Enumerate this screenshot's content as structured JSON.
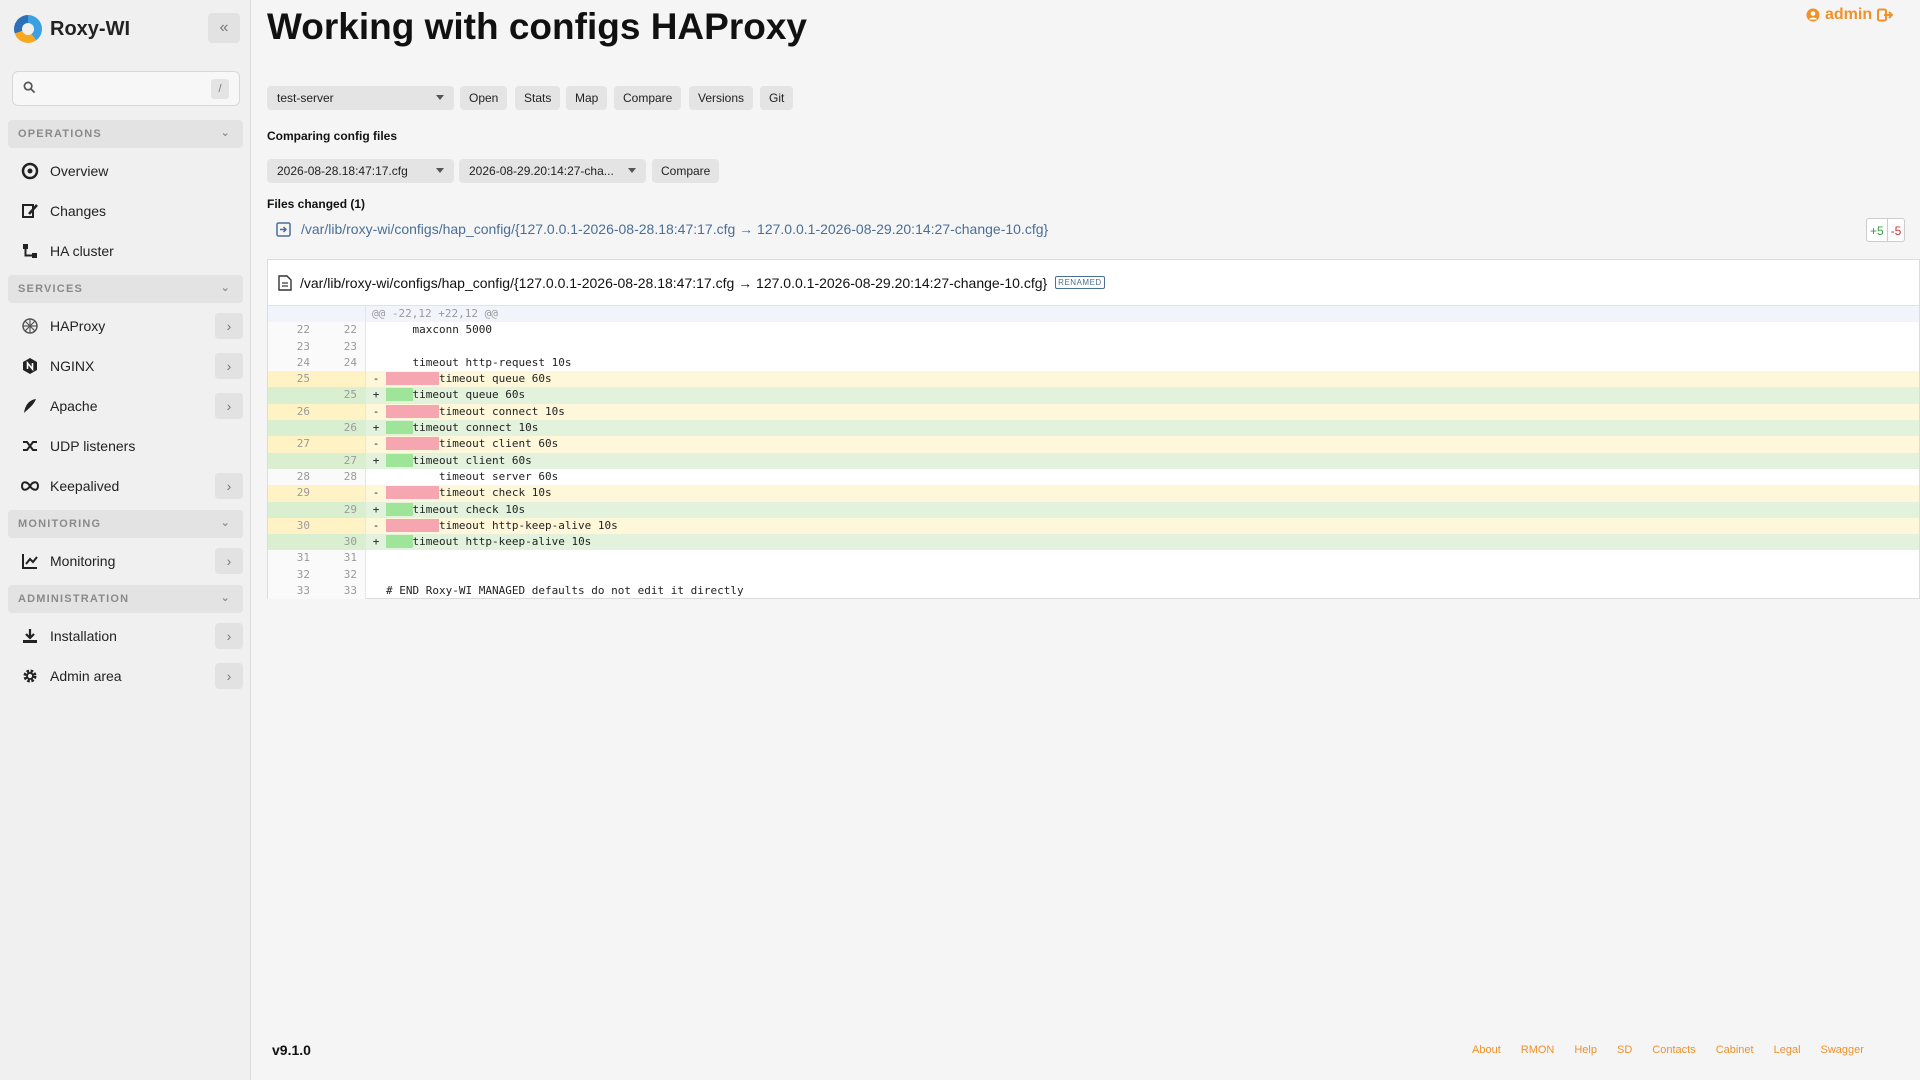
{
  "app": {
    "name": "Roxy-WI",
    "version": "v9.1.0"
  },
  "user": {
    "name": "admin"
  },
  "sidebar": {
    "search_placeholder": "",
    "search_shortcut": "/",
    "sections": [
      {
        "label": "OPERATIONS"
      },
      {
        "label": "SERVICES"
      },
      {
        "label": "MONITORING"
      },
      {
        "label": "ADMINISTRATION"
      }
    ],
    "items": [
      {
        "label": "Overview"
      },
      {
        "label": "Changes"
      },
      {
        "label": "HA cluster"
      },
      {
        "label": "HAProxy"
      },
      {
        "label": "NGINX"
      },
      {
        "label": "Apache"
      },
      {
        "label": "UDP listeners"
      },
      {
        "label": "Keepalived"
      },
      {
        "label": "Monitoring"
      },
      {
        "label": "Installation"
      },
      {
        "label": "Admin area"
      }
    ]
  },
  "main": {
    "title": "Working with configs HAProxy",
    "server_select": "test-server",
    "actions": [
      "Open",
      "Stats",
      "Map",
      "Compare",
      "Versions",
      "Git"
    ],
    "compare_label": "Comparing config files",
    "left_file": "2026-08-28.18:47:17.cfg",
    "right_file": "2026-08-29.20:14:27-cha...",
    "compare_button": "Compare",
    "files_changed": "Files changed (1)",
    "file_path": "/var/lib/roxy-wi/configs/hap_config/{127.0.0.1-2026-08-28.18:47:17.cfg → 127.0.0.1-2026-08-29.20:14:27-change-10.cfg}",
    "additions": "+5",
    "deletions": "-5",
    "renamed_badge": "RENAMED",
    "diff": {
      "hunk": "@@ -22,12 +22,12 @@",
      "lines": [
        {
          "old": "22",
          "new": "22",
          "sign": "",
          "indent": "    ",
          "text": "maxconn 5000"
        },
        {
          "old": "23",
          "new": "23",
          "sign": "",
          "indent": "",
          "text": ""
        },
        {
          "old": "24",
          "new": "24",
          "sign": "",
          "indent": "    ",
          "text": "timeout http-request 10s"
        },
        {
          "old": "25",
          "new": "",
          "sign": "-",
          "indent": "        ",
          "text": "timeout queue 60s"
        },
        {
          "old": "",
          "new": "25",
          "sign": "+",
          "indent": "    ",
          "text": "timeout queue 60s"
        },
        {
          "old": "26",
          "new": "",
          "sign": "-",
          "indent": "        ",
          "text": "timeout connect 10s"
        },
        {
          "old": "",
          "new": "26",
          "sign": "+",
          "indent": "    ",
          "text": "timeout connect 10s"
        },
        {
          "old": "27",
          "new": "",
          "sign": "-",
          "indent": "        ",
          "text": "timeout client 60s"
        },
        {
          "old": "",
          "new": "27",
          "sign": "+",
          "indent": "    ",
          "text": "timeout client 60s"
        },
        {
          "old": "28",
          "new": "28",
          "sign": "",
          "indent": "        ",
          "text": "timeout server 60s"
        },
        {
          "old": "29",
          "new": "",
          "sign": "-",
          "indent": "        ",
          "text": "timeout check 10s"
        },
        {
          "old": "",
          "new": "29",
          "sign": "+",
          "indent": "    ",
          "text": "timeout check 10s"
        },
        {
          "old": "30",
          "new": "",
          "sign": "-",
          "indent": "        ",
          "text": "timeout http-keep-alive 10s"
        },
        {
          "old": "",
          "new": "30",
          "sign": "+",
          "indent": "    ",
          "text": "timeout http-keep-alive 10s"
        },
        {
          "old": "31",
          "new": "31",
          "sign": "",
          "indent": "",
          "text": ""
        },
        {
          "old": "32",
          "new": "32",
          "sign": "",
          "indent": "",
          "text": ""
        },
        {
          "old": "33",
          "new": "33",
          "sign": "",
          "indent": "",
          "text": "# END Roxy-WI MANAGED defaults do not edit it directly"
        }
      ]
    }
  },
  "footer": {
    "links": [
      "About",
      "RMON",
      "Help",
      "SD",
      "Contacts",
      "Cabinet",
      "Legal",
      "Swagger"
    ]
  },
  "colors": {
    "accent": "#f0912a",
    "link": "#4a6f96",
    "added": "#9ee59a",
    "removed": "#f6a6b0"
  }
}
